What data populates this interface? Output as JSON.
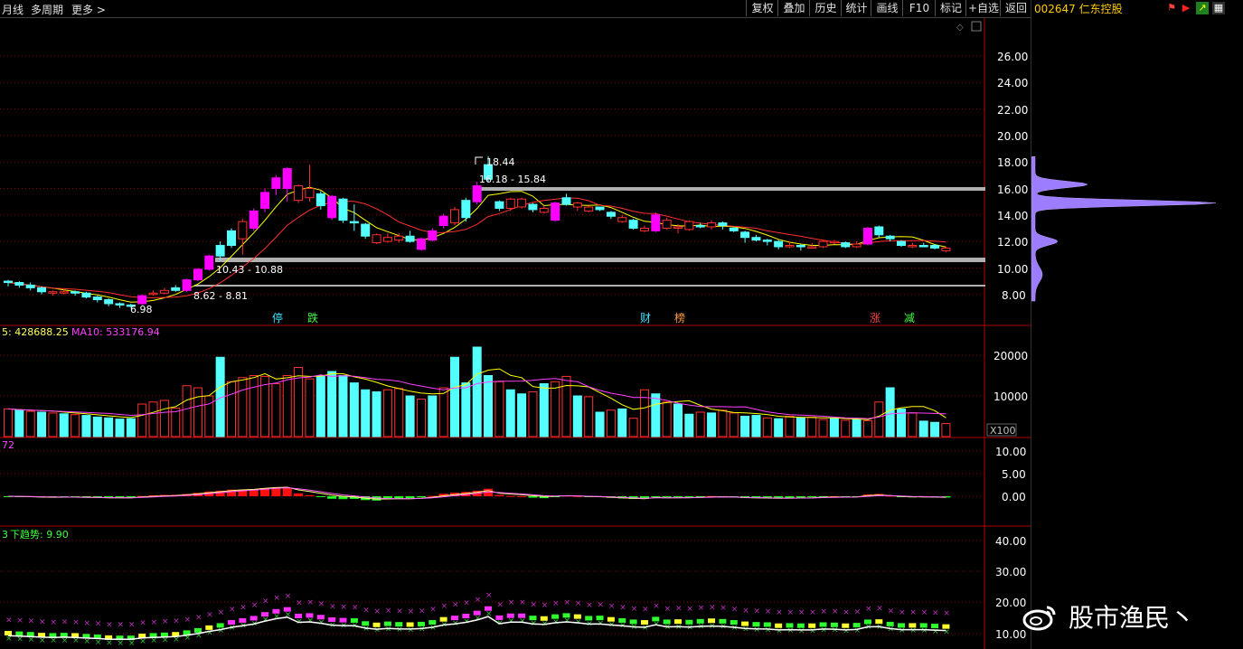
{
  "toolbar": {
    "left": [
      "月线",
      "多周期",
      "更多 >"
    ],
    "right": [
      "复权",
      "叠加",
      "历史",
      "统计",
      "画线",
      "F10",
      "标记",
      "+自选",
      "返回"
    ]
  },
  "stock": {
    "code": "002647",
    "name": "仁东控股",
    "title": "002647 仁东控股"
  },
  "price_axis": [
    "26.00",
    "24.00",
    "22.00",
    "20.00",
    "18.00",
    "16.00",
    "14.00",
    "12.00",
    "10.00",
    "8.00"
  ],
  "price_annotations": {
    "high": "18.44",
    "zone_upper": "16.18 - 15.84",
    "zone_lower": "10.43 - 10.88",
    "zone_bottom": "8.62 - 8.81",
    "low": "6.98"
  },
  "event_markers": [
    {
      "label": "停",
      "color": "#40e0ff"
    },
    {
      "label": "跌",
      "color": "#40ff40"
    },
    {
      "label": "财",
      "color": "#40e0ff"
    },
    {
      "label": "榜",
      "color": "#ff9a40"
    },
    {
      "label": "涨",
      "color": "#ff4040"
    },
    {
      "label": "减",
      "color": "#40ff40"
    }
  ],
  "volume_panel": {
    "header": "5: 428688.25",
    "ma10": "MA10: 533176.94",
    "axis": [
      "20000",
      "10000"
    ],
    "unit": "X100"
  },
  "macd_panel": {
    "header": "72",
    "axis": [
      "10.00",
      "5.00",
      "0.00"
    ]
  },
  "trend_panel": {
    "header_prefix": "3",
    "header": "下趋势: 9.90",
    "axis": [
      "40.00",
      "30.00",
      "20.00",
      "10.00"
    ]
  },
  "watermark": {
    "text": "股市渔民丶"
  },
  "colors": {
    "up": "#ff3030",
    "down": "#54ffff",
    "limit": "#ff00ff",
    "ma_short": "#ffff00",
    "ma_long": "#ff3030",
    "grid": "#8b0000",
    "axis_text": "#ffffff",
    "title": "#ffcc00"
  },
  "chart_data": {
    "type": "candlestick",
    "ylim": [
      6.5,
      27.5
    ],
    "candles": [
      [
        9.0,
        8.9,
        9.1,
        8.6,
        "d"
      ],
      [
        8.9,
        8.7,
        9.0,
        8.5,
        "d"
      ],
      [
        8.7,
        8.5,
        8.9,
        8.3,
        "d"
      ],
      [
        8.5,
        8.2,
        8.6,
        8.0,
        "d"
      ],
      [
        8.2,
        8.1,
        8.3,
        7.9,
        "u"
      ],
      [
        8.1,
        8.2,
        8.4,
        8.0,
        "u"
      ],
      [
        8.2,
        8.1,
        8.3,
        7.9,
        "d"
      ],
      [
        8.1,
        7.8,
        8.2,
        7.7,
        "d"
      ],
      [
        7.8,
        7.6,
        7.9,
        7.4,
        "d"
      ],
      [
        7.6,
        7.3,
        7.7,
        7.1,
        "d"
      ],
      [
        7.3,
        7.2,
        7.4,
        6.98,
        "d"
      ],
      [
        7.2,
        7.2,
        7.3,
        7.0,
        "d"
      ],
      [
        7.3,
        7.9,
        8.0,
        7.2,
        "l"
      ],
      [
        8.0,
        8.1,
        8.3,
        7.9,
        "u"
      ],
      [
        8.1,
        8.3,
        8.5,
        8.0,
        "u"
      ],
      [
        8.3,
        8.5,
        8.7,
        8.2,
        "d"
      ],
      [
        8.3,
        9.1,
        9.2,
        8.2,
        "l"
      ],
      [
        9.1,
        9.9,
        10.0,
        9.0,
        "l"
      ],
      [
        9.9,
        10.9,
        11.0,
        9.8,
        "l"
      ],
      [
        10.9,
        11.7,
        12.0,
        10.6,
        "d"
      ],
      [
        11.7,
        12.8,
        13.0,
        11.5,
        "d"
      ],
      [
        12.2,
        13.5,
        13.7,
        11.0,
        "u"
      ],
      [
        13.0,
        14.3,
        14.5,
        12.8,
        "l"
      ],
      [
        14.5,
        15.7,
        16.0,
        14.2,
        "l"
      ],
      [
        16.0,
        16.8,
        17.0,
        15.5,
        "l"
      ],
      [
        16.0,
        17.5,
        17.6,
        15.0,
        "l"
      ],
      [
        16.2,
        15.1,
        16.3,
        14.9,
        "u"
      ],
      [
        16.0,
        15.3,
        17.8,
        15.0,
        "u"
      ],
      [
        15.6,
        14.7,
        15.8,
        14.4,
        "d"
      ],
      [
        15.4,
        13.8,
        15.5,
        13.6,
        "l"
      ],
      [
        15.2,
        13.6,
        15.3,
        13.4,
        "d"
      ],
      [
        13.5,
        13.5,
        14.8,
        12.8,
        "d"
      ],
      [
        13.3,
        12.4,
        13.4,
        12.2,
        "d"
      ],
      [
        12.5,
        11.9,
        12.6,
        11.8,
        "u"
      ],
      [
        12.0,
        12.3,
        12.6,
        11.9,
        "u"
      ],
      [
        12.4,
        12.1,
        12.6,
        11.9,
        "u"
      ],
      [
        12.4,
        12.0,
        12.8,
        11.9,
        "d"
      ],
      [
        11.4,
        12.2,
        12.3,
        11.3,
        "l"
      ],
      [
        12.1,
        12.8,
        13.0,
        12.0,
        "l"
      ],
      [
        13.2,
        13.9,
        14.1,
        13.0,
        "l"
      ],
      [
        13.4,
        14.4,
        14.6,
        13.2,
        "u"
      ],
      [
        13.8,
        15.1,
        15.3,
        13.5,
        "d"
      ],
      [
        15.0,
        16.2,
        16.5,
        14.8,
        "l"
      ],
      [
        16.7,
        17.8,
        18.44,
        16.5,
        "d"
      ],
      [
        15.0,
        14.5,
        15.1,
        14.3,
        "d"
      ],
      [
        14.5,
        15.2,
        15.3,
        14.3,
        "u"
      ],
      [
        14.6,
        15.2,
        15.3,
        14.5,
        "u"
      ],
      [
        14.8,
        14.4,
        14.9,
        14.2,
        "d"
      ],
      [
        14.5,
        14.2,
        14.7,
        14.1,
        "u"
      ],
      [
        13.6,
        14.9,
        15.0,
        13.5,
        "l"
      ],
      [
        14.8,
        15.3,
        15.6,
        14.7,
        "d"
      ],
      [
        14.6,
        14.9,
        15.0,
        14.3,
        "u"
      ],
      [
        14.6,
        14.3,
        14.7,
        14.2,
        "u"
      ],
      [
        14.6,
        14.4,
        14.6,
        14.3,
        "d"
      ],
      [
        14.2,
        13.9,
        14.3,
        13.7,
        "d"
      ],
      [
        13.8,
        13.5,
        14.0,
        13.4,
        "u"
      ],
      [
        13.6,
        13.0,
        13.7,
        12.9,
        "d"
      ],
      [
        13.0,
        12.8,
        13.2,
        12.7,
        "u"
      ],
      [
        12.8,
        14.0,
        14.2,
        12.7,
        "l"
      ],
      [
        13.6,
        13.0,
        13.8,
        12.9,
        "u"
      ],
      [
        13.0,
        13.1,
        13.3,
        12.6,
        "u"
      ],
      [
        13.5,
        12.9,
        13.6,
        12.8,
        "u"
      ],
      [
        13.1,
        13.2,
        13.4,
        13.0,
        "d"
      ],
      [
        13.1,
        13.4,
        13.6,
        12.9,
        "u"
      ],
      [
        13.4,
        13.2,
        13.5,
        12.9,
        "d"
      ],
      [
        13.0,
        12.8,
        13.1,
        12.7,
        "d"
      ],
      [
        12.7,
        12.3,
        12.8,
        11.9,
        "d"
      ],
      [
        12.3,
        12.1,
        12.5,
        12.0,
        "d"
      ],
      [
        12.1,
        12.0,
        12.2,
        11.7,
        "d"
      ],
      [
        12.0,
        11.6,
        12.1,
        11.4,
        "d"
      ],
      [
        11.6,
        11.7,
        12.0,
        11.5,
        "u"
      ],
      [
        11.7,
        11.6,
        11.8,
        11.3,
        "d"
      ],
      [
        11.6,
        11.6,
        11.9,
        11.5,
        "u"
      ],
      [
        11.6,
        12.0,
        12.1,
        11.5,
        "u"
      ],
      [
        12.0,
        11.9,
        12.1,
        11.8,
        "u"
      ],
      [
        11.9,
        11.6,
        12.0,
        11.5,
        "d"
      ],
      [
        11.6,
        11.8,
        12.0,
        11.5,
        "u"
      ],
      [
        11.8,
        13.0,
        13.1,
        11.7,
        "l"
      ],
      [
        12.5,
        13.1,
        13.2,
        12.3,
        "d"
      ],
      [
        12.4,
        12.2,
        12.5,
        12.0,
        "d"
      ],
      [
        12.0,
        11.7,
        12.1,
        11.6,
        "d"
      ],
      [
        11.6,
        11.7,
        11.9,
        11.5,
        "u"
      ],
      [
        11.7,
        11.7,
        11.9,
        11.6,
        "d"
      ],
      [
        11.7,
        11.5,
        11.8,
        11.4,
        "d"
      ],
      [
        11.5,
        11.3,
        11.6,
        11.2,
        "u"
      ]
    ],
    "volumes": [
      [
        6800,
        "u"
      ],
      [
        6500,
        "d"
      ],
      [
        6200,
        "u"
      ],
      [
        6000,
        "d"
      ],
      [
        5800,
        "u"
      ],
      [
        5600,
        "d"
      ],
      [
        5400,
        "u"
      ],
      [
        5200,
        "d"
      ],
      [
        4800,
        "d"
      ],
      [
        4600,
        "d"
      ],
      [
        4300,
        "d"
      ],
      [
        4400,
        "d"
      ],
      [
        8000,
        "u"
      ],
      [
        8500,
        "u"
      ],
      [
        8900,
        "u"
      ],
      [
        7000,
        "u"
      ],
      [
        12500,
        "u"
      ],
      [
        12000,
        "u"
      ],
      [
        10000,
        "u"
      ],
      [
        19500,
        "d"
      ],
      [
        13500,
        "u"
      ],
      [
        14500,
        "u"
      ],
      [
        15000,
        "u"
      ],
      [
        14800,
        "u"
      ],
      [
        13000,
        "u"
      ],
      [
        15000,
        "u"
      ],
      [
        17000,
        "u"
      ],
      [
        14200,
        "u"
      ],
      [
        15000,
        "d"
      ],
      [
        16000,
        "d"
      ],
      [
        15000,
        "d"
      ],
      [
        13200,
        "d"
      ],
      [
        11500,
        "d"
      ],
      [
        11000,
        "d"
      ],
      [
        11500,
        "u"
      ],
      [
        11800,
        "u"
      ],
      [
        10000,
        "d"
      ],
      [
        9200,
        "u"
      ],
      [
        10000,
        "d"
      ],
      [
        12000,
        "u"
      ],
      [
        19500,
        "d"
      ],
      [
        13200,
        "d"
      ],
      [
        22000,
        "d"
      ],
      [
        15000,
        "d"
      ],
      [
        13500,
        "u"
      ],
      [
        11500,
        "d"
      ],
      [
        10500,
        "d"
      ],
      [
        11000,
        "u"
      ],
      [
        13000,
        "d"
      ],
      [
        13500,
        "u"
      ],
      [
        14800,
        "u"
      ],
      [
        10000,
        "d"
      ],
      [
        9800,
        "u"
      ],
      [
        6000,
        "d"
      ],
      [
        6500,
        "u"
      ],
      [
        6800,
        "d"
      ],
      [
        4500,
        "u"
      ],
      [
        11500,
        "u"
      ],
      [
        10500,
        "d"
      ],
      [
        8500,
        "u"
      ],
      [
        8000,
        "d"
      ],
      [
        5500,
        "d"
      ],
      [
        6000,
        "u"
      ],
      [
        5800,
        "d"
      ],
      [
        6500,
        "u"
      ],
      [
        5800,
        "u"
      ],
      [
        5000,
        "d"
      ],
      [
        5200,
        "d"
      ],
      [
        4600,
        "u"
      ],
      [
        4400,
        "d"
      ],
      [
        5000,
        "u"
      ],
      [
        4600,
        "d"
      ],
      [
        4800,
        "u"
      ],
      [
        4200,
        "u"
      ],
      [
        4500,
        "d"
      ],
      [
        4000,
        "u"
      ],
      [
        4200,
        "d"
      ],
      [
        3900,
        "u"
      ],
      [
        8500,
        "u"
      ],
      [
        12000,
        "d"
      ],
      [
        6800,
        "d"
      ],
      [
        5800,
        "u"
      ],
      [
        3800,
        "d"
      ],
      [
        3500,
        "d"
      ],
      [
        3200,
        "u"
      ]
    ]
  }
}
